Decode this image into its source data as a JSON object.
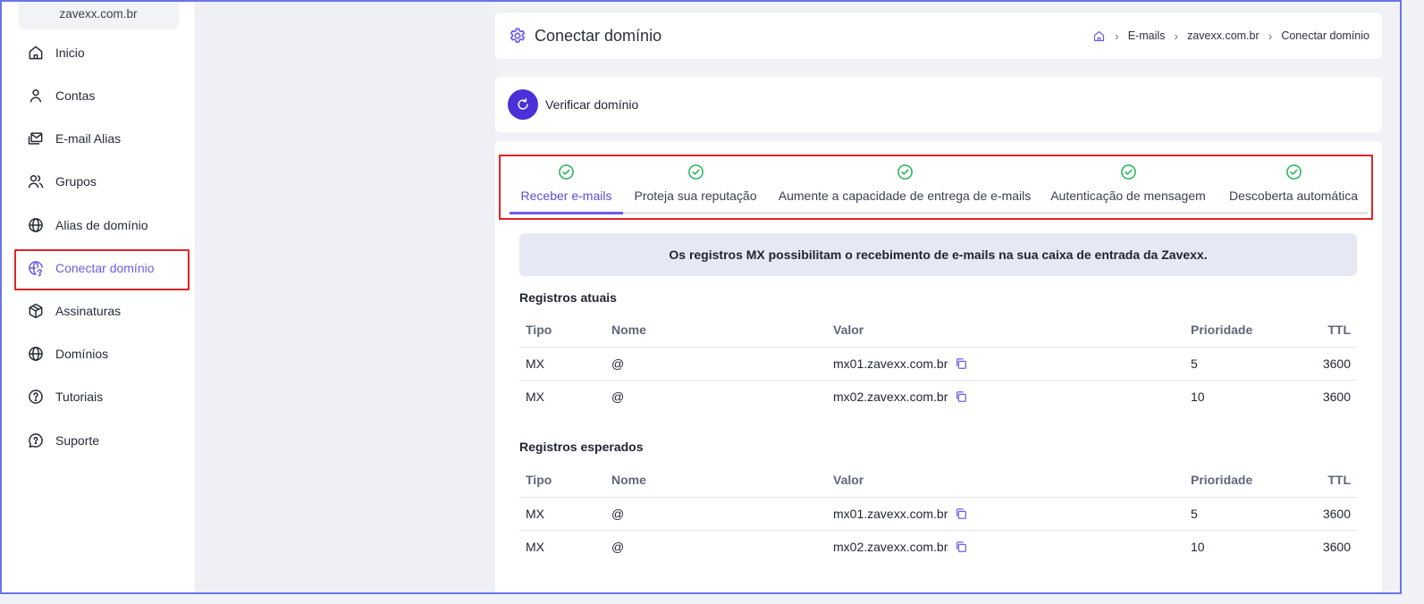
{
  "sidebar": {
    "domain": "zavexx.com.br",
    "items": [
      {
        "label": "Inicio",
        "icon": "home-icon"
      },
      {
        "label": "Contas",
        "icon": "user-icon"
      },
      {
        "label": "E-mail Alias",
        "icon": "mail-stack-icon"
      },
      {
        "label": "Grupos",
        "icon": "users-icon"
      },
      {
        "label": "Alias de domínio",
        "icon": "globe-icon"
      },
      {
        "label": "Conectar domínio",
        "icon": "globe-link-icon",
        "active": true
      },
      {
        "label": "Assinaturas",
        "icon": "package-icon"
      },
      {
        "label": "Domínios",
        "icon": "globe-icon"
      },
      {
        "label": "Tutoriais",
        "icon": "help-circle-icon"
      },
      {
        "label": "Suporte",
        "icon": "chat-help-icon"
      }
    ]
  },
  "header": {
    "title": "Conectar domínio",
    "breadcrumb": [
      "E-mails",
      "zavexx.com.br",
      "Conectar domínio"
    ]
  },
  "verify": {
    "label": "Verificar domínio"
  },
  "tabs": [
    {
      "label": "Receber e-mails",
      "active": true
    },
    {
      "label": "Proteja sua reputação"
    },
    {
      "label": "Aumente a capacidade de entrega de e-mails"
    },
    {
      "label": "Autenticação de mensagem"
    },
    {
      "label": "Descoberta automática"
    }
  ],
  "banner": "Os registros MX possibilitam o recebimento de e-mails na sua caixa de entrada da Zavexx.",
  "columns": [
    "Tipo",
    "Nome",
    "Valor",
    "Prioridade",
    "TTL"
  ],
  "current": {
    "title": "Registros atuais",
    "rows": [
      {
        "tipo": "MX",
        "nome": "@",
        "valor": "mx01.zavexx.com.br",
        "prioridade": "5",
        "ttl": "3600"
      },
      {
        "tipo": "MX",
        "nome": "@",
        "valor": "mx02.zavexx.com.br",
        "prioridade": "10",
        "ttl": "3600"
      }
    ]
  },
  "expected": {
    "title": "Registros esperados",
    "rows": [
      {
        "tipo": "MX",
        "nome": "@",
        "valor": "mx01.zavexx.com.br",
        "prioridade": "5",
        "ttl": "3600"
      },
      {
        "tipo": "MX",
        "nome": "@",
        "valor": "mx02.zavexx.com.br",
        "prioridade": "10",
        "ttl": "3600"
      }
    ]
  },
  "colors": {
    "accent": "#6c5ce7",
    "verify_button": "#4b30d8",
    "check_green": "#22b35a",
    "highlight_red": "#e02424"
  }
}
